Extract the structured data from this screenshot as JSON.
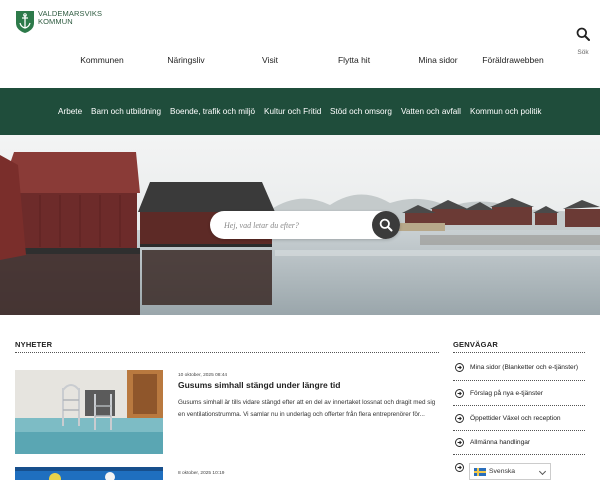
{
  "header": {
    "logo_line1": "VALDEMARSVIKS",
    "logo_line2": "KOMMUN",
    "search_label": "Sök"
  },
  "main_nav": [
    "Kommunen",
    "Näringsliv",
    "Visit",
    "Flytta hit",
    "Mina sidor",
    "Föräldrawebben"
  ],
  "sub_nav": [
    "Arbete",
    "Barn och utbildning",
    "Boende, trafik och miljö",
    "Kultur och Fritid",
    "Stöd och omsorg",
    "Vatten och avfall",
    "Kommun och politik"
  ],
  "hero": {
    "search_placeholder": "Hej, vad letar du efter?"
  },
  "news": {
    "heading": "NYHETER",
    "items": [
      {
        "date": "10 oktober, 2025 08:44",
        "title": "Gusums simhall stängd under längre tid",
        "text": "Gusums simhall är tills vidare stängd efter att en del av innertaket lossnat och dragit med sig en ventilationstrumma. Vi samlar nu in underlag och offerter från flera entreprenörer för..."
      },
      {
        "date": "8 oktober, 2025 10:19"
      }
    ]
  },
  "shortcuts": {
    "heading": "GENVÄGAR",
    "items": [
      "Mina sidor (Blanketter och e-tjänster)",
      "Förslag på nya e-tjänster",
      "Öppettider Växel och reception",
      "Allmänna handlingar"
    ]
  },
  "language": {
    "selected": "Svenska"
  },
  "colors": {
    "brand_green": "#1f4d3b",
    "logo_green": "#2d5a3f"
  }
}
